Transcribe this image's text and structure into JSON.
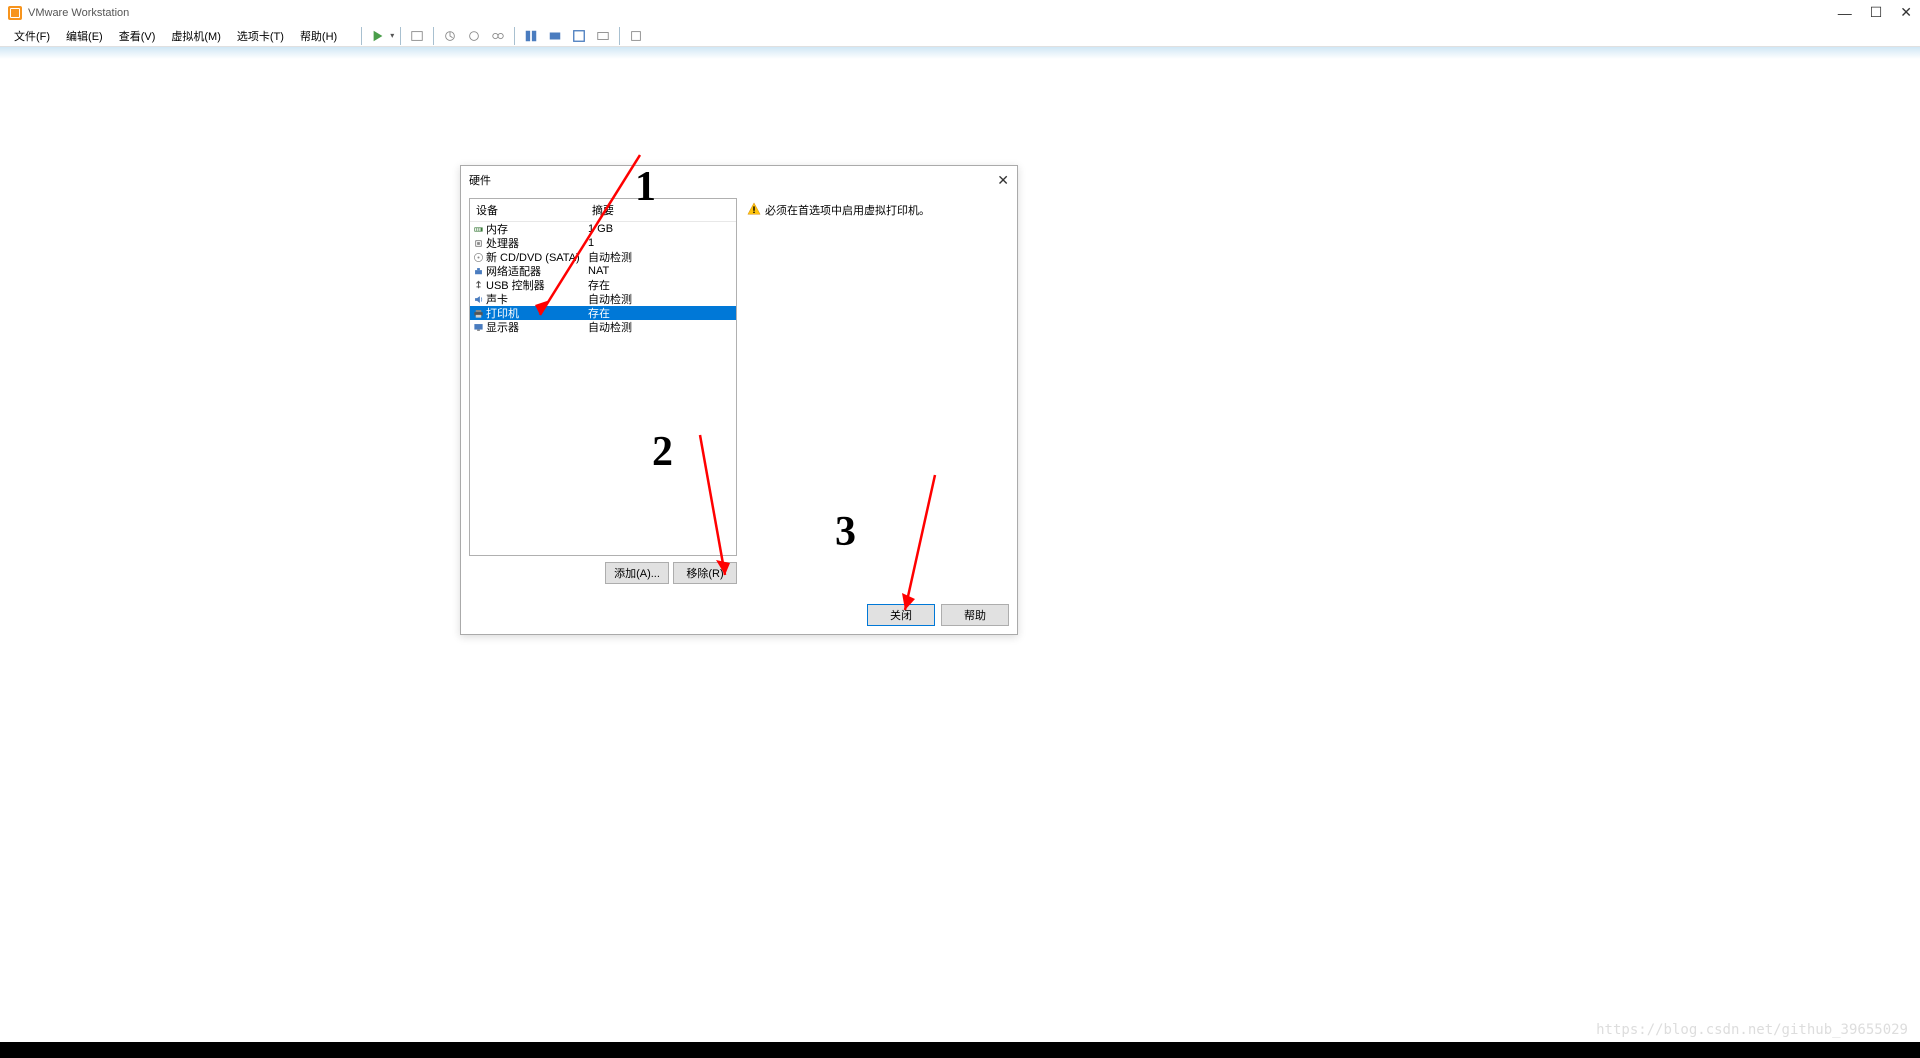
{
  "app": {
    "title": "VMware Workstation"
  },
  "menu": {
    "items": [
      "文件(F)",
      "编辑(E)",
      "查看(V)",
      "虚拟机(M)",
      "选项卡(T)",
      "帮助(H)"
    ]
  },
  "dialog": {
    "title": "硬件",
    "header_device": "设备",
    "header_summary": "摘要",
    "rows": [
      {
        "icon": "memory",
        "name": "内存",
        "summary": "1 GB",
        "selected": false
      },
      {
        "icon": "cpu",
        "name": "处理器",
        "summary": "1",
        "selected": false
      },
      {
        "icon": "cd",
        "name": "新 CD/DVD (SATA)",
        "summary": "自动检测",
        "selected": false
      },
      {
        "icon": "network",
        "name": "网络适配器",
        "summary": "NAT",
        "selected": false
      },
      {
        "icon": "usb",
        "name": "USB 控制器",
        "summary": "存在",
        "selected": false
      },
      {
        "icon": "sound",
        "name": "声卡",
        "summary": "自动检测",
        "selected": false
      },
      {
        "icon": "printer",
        "name": "打印机",
        "summary": "存在",
        "selected": true
      },
      {
        "icon": "display",
        "name": "显示器",
        "summary": "自动检测",
        "selected": false
      }
    ],
    "add_btn": "添加(A)...",
    "remove_btn": "移除(R)",
    "warning": "必须在首选项中启用虚拟打印机。",
    "close_btn": "关闭",
    "help_btn": "帮助"
  },
  "annotations": {
    "n1": "1",
    "n2": "2",
    "n3": "3"
  },
  "watermark": "https://blog.csdn.net/github_39655029"
}
